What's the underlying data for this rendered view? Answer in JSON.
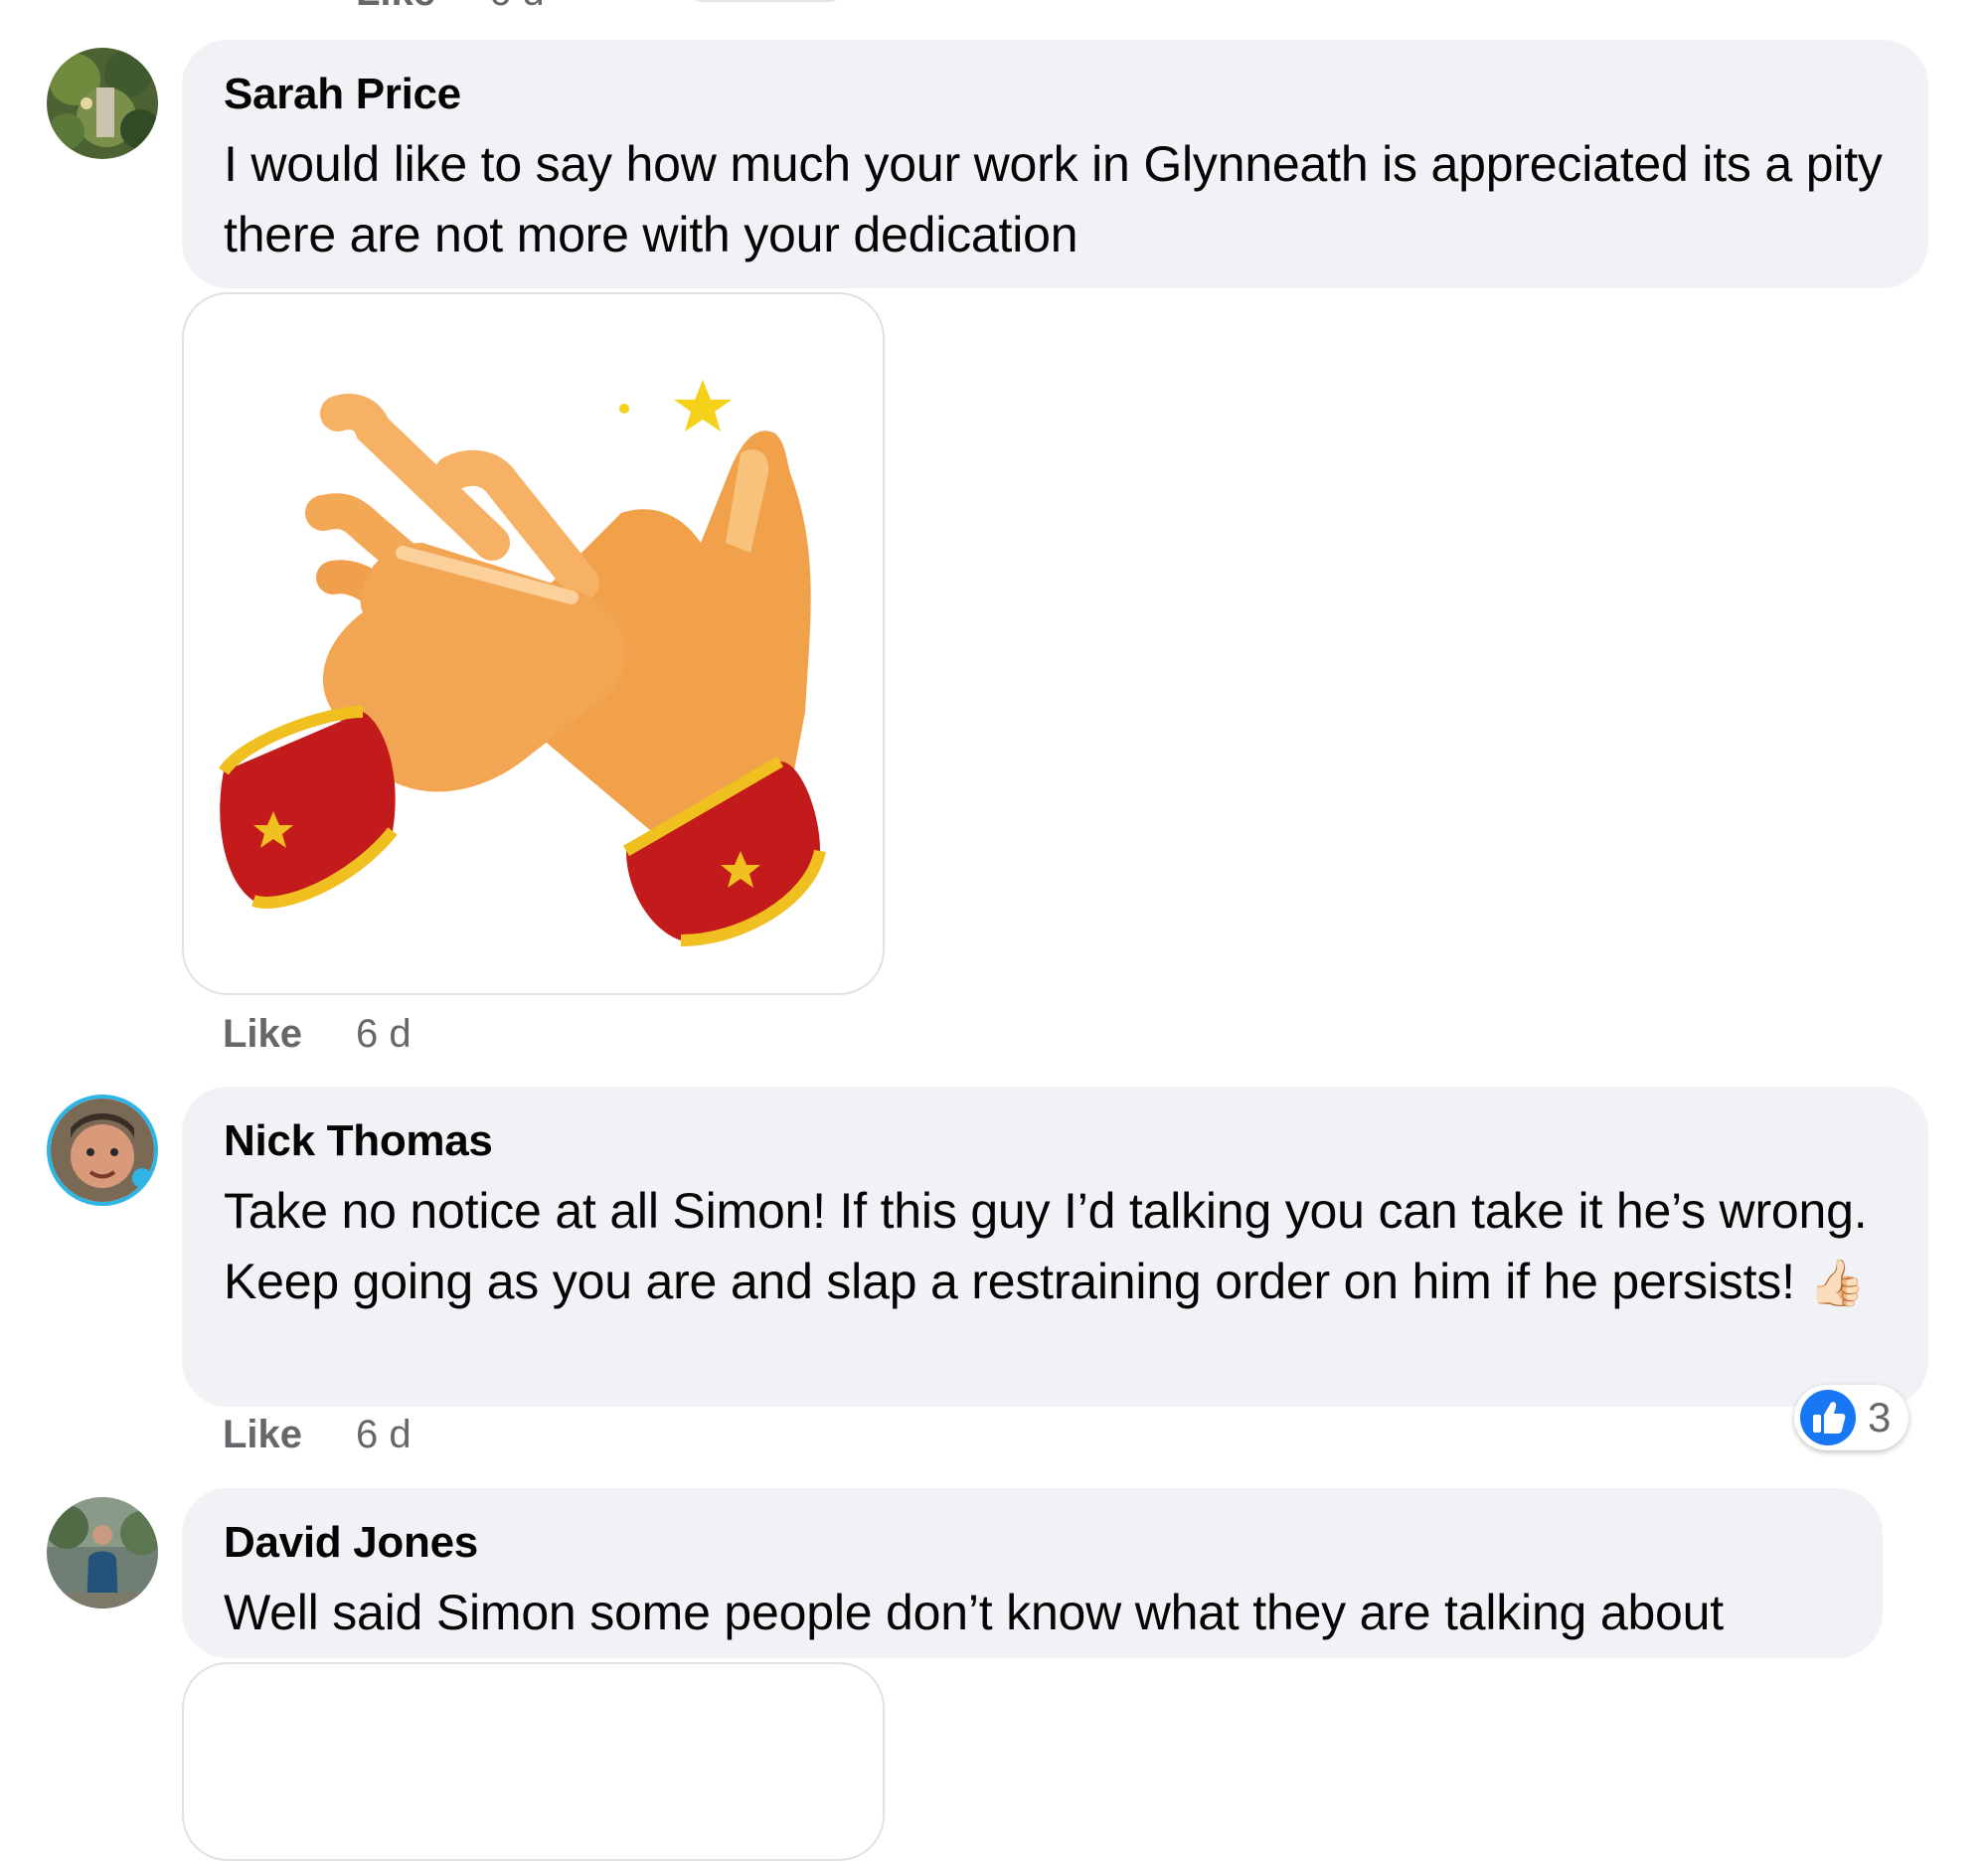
{
  "top_fragment": {
    "like_label": "Like",
    "time": "6 d"
  },
  "comments": [
    {
      "author": "Sarah Price",
      "text": "I would like to say how much your work in Glynneath is appreciated its a pity there are not more with your dedication",
      "sticker": "clapping-hands-sticker",
      "like_label": "Like",
      "time": "6 d"
    },
    {
      "author": "Nick Thomas",
      "text": "Take no notice at all Simon! If this guy I’d talking you can take it he’s wrong. Keep going as you are and slap a restraining order on him if he persists!",
      "emoji": "👍🏻",
      "reaction": {
        "icon": "like-reaction-icon",
        "count": "3"
      },
      "like_label": "Like",
      "time": "6 d"
    },
    {
      "author": "David Jones",
      "text": "Well said Simon some people don’t know what they are talking about",
      "sticker": "sticker-partial"
    }
  ],
  "colors": {
    "bubble": "#f0f2f5",
    "meta_text": "#65676b",
    "like_blue": "#1877f2",
    "text": "#050505"
  }
}
